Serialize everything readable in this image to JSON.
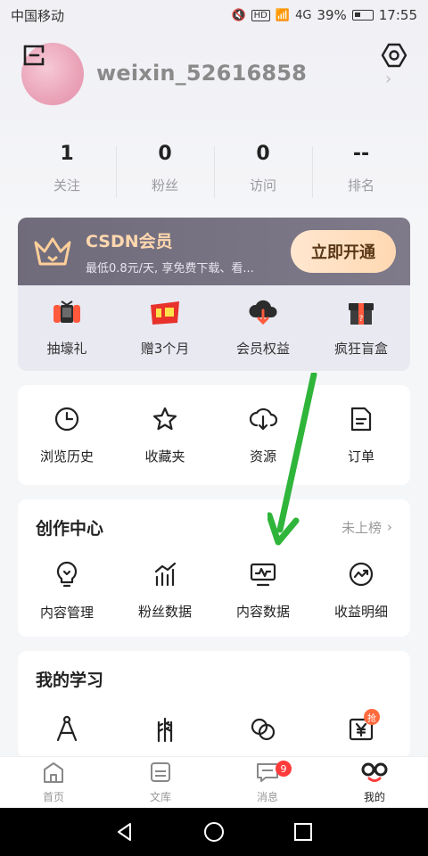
{
  "status_bar": {
    "carrier": "中国移动",
    "battery": "39%",
    "time": "17:55",
    "hd": "HD",
    "net": "4G"
  },
  "profile": {
    "username": "weixin_52616858"
  },
  "stats": [
    {
      "value": "1",
      "label": "关注"
    },
    {
      "value": "0",
      "label": "粉丝"
    },
    {
      "value": "0",
      "label": "访问"
    },
    {
      "value": "--",
      "label": "排名"
    }
  ],
  "vip": {
    "title": "CSDN会员",
    "desc": "最低0.8元/天, 享免费下载、看...",
    "cta": "立即开通",
    "benefits": [
      {
        "label": "抽壕礼",
        "icon": "game-controller-icon"
      },
      {
        "label": "赠3个月",
        "icon": "gift-promo-icon"
      },
      {
        "label": "会员权益",
        "icon": "cloud-download-icon"
      },
      {
        "label": "疯狂盲盒",
        "icon": "mystery-box-icon"
      }
    ]
  },
  "quick": [
    {
      "label": "浏览历史",
      "icon": "clock-icon"
    },
    {
      "label": "收藏夹",
      "icon": "star-icon"
    },
    {
      "label": "资源",
      "icon": "cloud-download-icon"
    },
    {
      "label": "订单",
      "icon": "document-icon"
    }
  ],
  "creation": {
    "title": "创作中心",
    "link": "未上榜",
    "items": [
      {
        "label": "内容管理",
        "icon": "lightbulb-icon"
      },
      {
        "label": "粉丝数据",
        "icon": "bar-chart-icon"
      },
      {
        "label": "内容数据",
        "icon": "monitor-chart-icon"
      },
      {
        "label": "收益明细",
        "icon": "trend-circle-icon"
      }
    ]
  },
  "learning": {
    "title": "我的学习",
    "badge": "抢",
    "items": [
      {
        "icon": "compass-icon"
      },
      {
        "icon": "wheat-icon"
      },
      {
        "icon": "rings-icon"
      },
      {
        "icon": "yen-icon"
      }
    ]
  },
  "tabs": [
    {
      "label": "首页",
      "icon": "home-icon"
    },
    {
      "label": "文库",
      "icon": "library-icon"
    },
    {
      "label": "消息",
      "icon": "message-icon",
      "badge": "9"
    },
    {
      "label": "我的",
      "icon": "profile-icon"
    }
  ],
  "colors": {
    "accent": "#ff3b3b",
    "vip_gold": "#ffd7ae",
    "arrow_green": "#2fb53a"
  }
}
